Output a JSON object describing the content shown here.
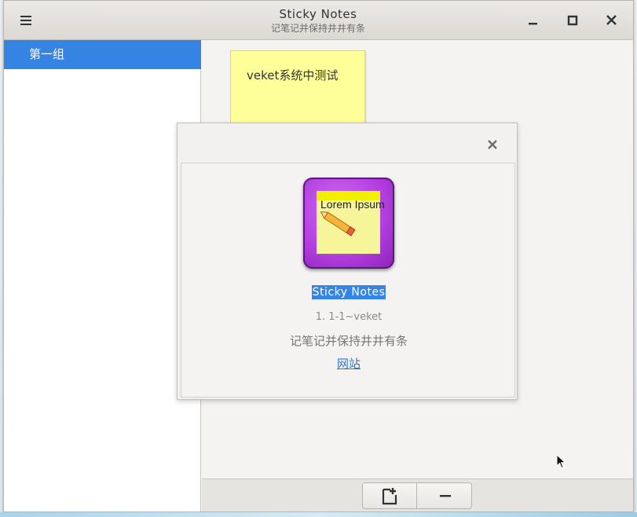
{
  "window": {
    "title": "Sticky Notes",
    "subtitle": "记笔记并保持井井有条"
  },
  "sidebar": {
    "items": [
      {
        "label": "第一组",
        "selected": true
      }
    ]
  },
  "notes": [
    {
      "text": "veket系统中测试"
    }
  ],
  "about_dialog": {
    "icon_text": "Lorem Ipsum",
    "app_name": "Sticky Notes",
    "version": "1. 1-1~veket",
    "description": "记笔记并保持井井有条",
    "website_label": "网站"
  },
  "icons": {
    "menu": "hamburger-menu-icon",
    "minimize": "minimize-icon",
    "maximize": "maximize-icon",
    "close": "close-icon",
    "add_note": "add-note-icon",
    "remove": "minus-icon"
  },
  "colors": {
    "accent": "#3584e4",
    "note": "#ffff99",
    "app_icon": "#b43fe0"
  }
}
